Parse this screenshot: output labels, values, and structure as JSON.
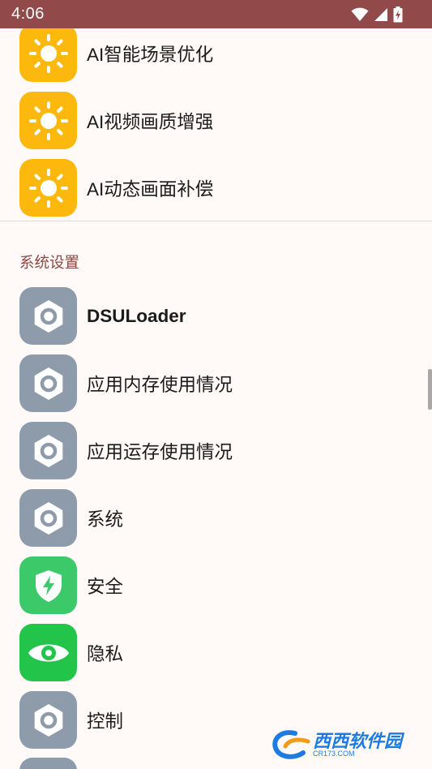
{
  "status_bar": {
    "time": "4:06",
    "bg_color": "#91494a"
  },
  "rows_top": [
    {
      "label": "AI智能场景优化",
      "icon": "sun-icon"
    },
    {
      "label": "AI视频画质增强",
      "icon": "sun-icon"
    },
    {
      "label": "AI动态画面补偿",
      "icon": "sun-icon"
    }
  ],
  "section": {
    "title": "系统设置"
  },
  "rows_system": [
    {
      "label": "DSULoader",
      "icon": "gear-hex-icon"
    },
    {
      "label": "应用内存使用情况",
      "icon": "gear-hex-icon"
    },
    {
      "label": "应用运存使用情况",
      "icon": "gear-hex-icon"
    },
    {
      "label": "系统",
      "icon": "gear-hex-icon"
    },
    {
      "label": "安全",
      "icon": "shield-bolt-icon"
    },
    {
      "label": "隐私",
      "icon": "eye-icon"
    },
    {
      "label": "控制",
      "icon": "gear-hex-icon"
    }
  ],
  "colors": {
    "accent": "#8b4a45",
    "sun_icon_bg": "#fdb80d",
    "gear_icon_bg": "#8e9bab",
    "security_icon_bg": "#3cc96a",
    "privacy_icon_bg": "#22c44a"
  },
  "watermark": {
    "text": "西西软件园",
    "sub": "CR173.COM"
  }
}
